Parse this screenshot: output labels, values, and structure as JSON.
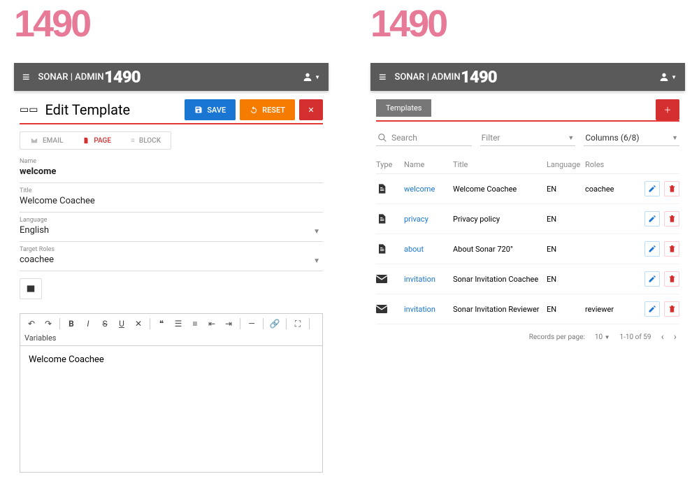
{
  "app": {
    "title": "SONAR | ADMIN",
    "logo_text": "1490"
  },
  "left": {
    "heading": "Edit Template",
    "buttons": {
      "save": "SAVE",
      "reset": "RESET"
    },
    "tabs": {
      "email": "EMAIL",
      "page": "PAGE",
      "block": "BLOCK"
    },
    "fields": {
      "name_label": "Name",
      "name_value": "welcome",
      "title_label": "Title",
      "title_value": "Welcome Coachee",
      "language_label": "Language",
      "language_value": "English",
      "roles_label": "Target Roles",
      "roles_value": "coachee"
    },
    "editor": {
      "content": "Welcome Coachee",
      "variables_label": "Variables"
    }
  },
  "right": {
    "tab": "Templates",
    "search_placeholder": "Search",
    "filter_label": "Filter",
    "columns_label": "Columns (6/8)",
    "headers": {
      "type": "Type",
      "name": "Name",
      "title": "Title",
      "language": "Language",
      "roles": "Roles"
    },
    "rows": [
      {
        "type": "page",
        "name": "welcome",
        "title": "Welcome Coachee",
        "lang": "EN",
        "roles": "coachee"
      },
      {
        "type": "page",
        "name": "privacy",
        "title": "Privacy policy",
        "lang": "EN",
        "roles": ""
      },
      {
        "type": "page",
        "name": "about",
        "title": "About Sonar 720°",
        "lang": "EN",
        "roles": ""
      },
      {
        "type": "email",
        "name": "invitation",
        "title": "Sonar Invitation Coachee",
        "lang": "EN",
        "roles": ""
      },
      {
        "type": "email",
        "name": "invitation",
        "title": "Sonar Invitation Reviewer",
        "lang": "EN",
        "roles": "reviewer"
      }
    ],
    "pager": {
      "rpp_label": "Records per page:",
      "rpp": "10",
      "range": "1-10 of 59"
    }
  }
}
